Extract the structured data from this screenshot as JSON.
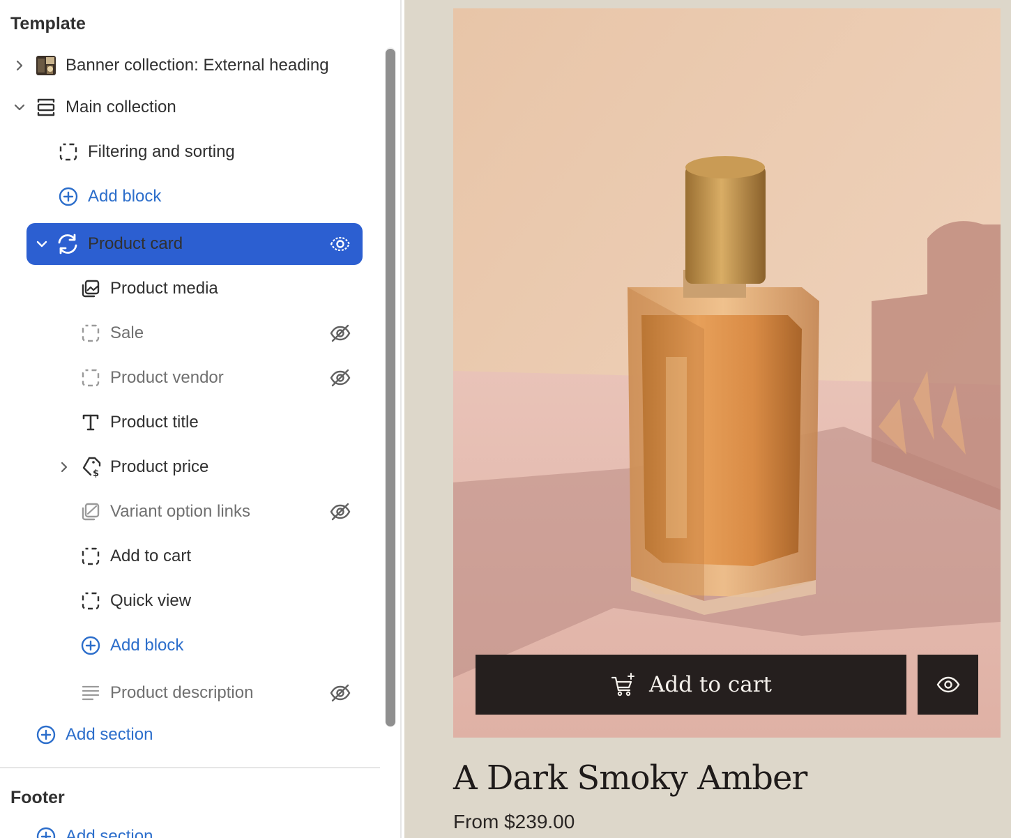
{
  "sidebar": {
    "template_heading": "Template",
    "footer_heading": "Footer",
    "footer_add_section": "Add section",
    "items": [
      {
        "label": "Banner collection: External heading",
        "icon": "banner-thumbnail"
      },
      {
        "label": "Main collection",
        "icon": "section-icon"
      },
      {
        "label": "Filtering and sorting",
        "icon": "block-outline-icon"
      },
      {
        "label": "Add block",
        "icon": "plus-circle-icon"
      },
      {
        "label": "Product card",
        "icon": "refresh-icon",
        "selected": true
      },
      {
        "label": "Product media",
        "icon": "media-icon"
      },
      {
        "label": "Sale",
        "icon": "block-outline-icon",
        "hidden": true
      },
      {
        "label": "Product vendor",
        "icon": "block-outline-icon",
        "hidden": true
      },
      {
        "label": "Product title",
        "icon": "text-icon"
      },
      {
        "label": "Product price",
        "icon": "price-tag-icon"
      },
      {
        "label": "Variant option links",
        "icon": "variant-icon",
        "hidden": true
      },
      {
        "label": "Add to cart",
        "icon": "block-outline-icon"
      },
      {
        "label": "Quick view",
        "icon": "block-outline-icon"
      },
      {
        "label": "Add block",
        "icon": "plus-circle-icon"
      },
      {
        "label": "Product description",
        "icon": "paragraph-icon",
        "hidden": true
      },
      {
        "label": "Add section",
        "icon": "plus-circle-icon"
      }
    ]
  },
  "preview": {
    "add_to_cart_label": "Add to cart",
    "product_title": "A Dark Smoky Amber",
    "product_price": "From $239.00"
  },
  "colors": {
    "accent": "#2c5fd1",
    "link": "#2c6ecb",
    "preview_bg": "#ddd7ca",
    "button_bg": "#251f1e"
  }
}
